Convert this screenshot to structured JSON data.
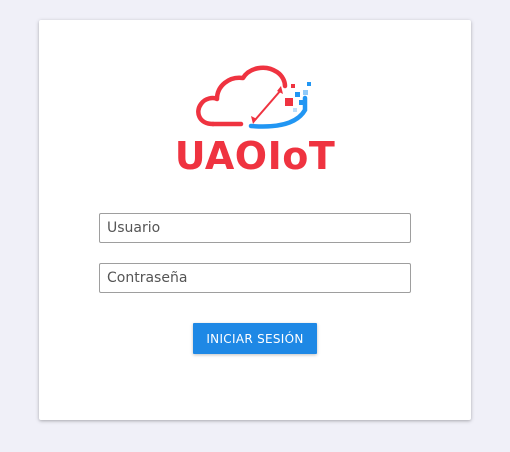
{
  "brand": {
    "name": "UAOIoT",
    "primary_color": "#ef3340",
    "accent_color": "#2196f3",
    "logo_icon": "cloud-iot-logo-icon"
  },
  "login_form": {
    "username_placeholder": "Usuario",
    "password_placeholder": "Contraseña",
    "submit_label": "INICIAR SESIÓN",
    "submit_color": "#1e88e5"
  }
}
